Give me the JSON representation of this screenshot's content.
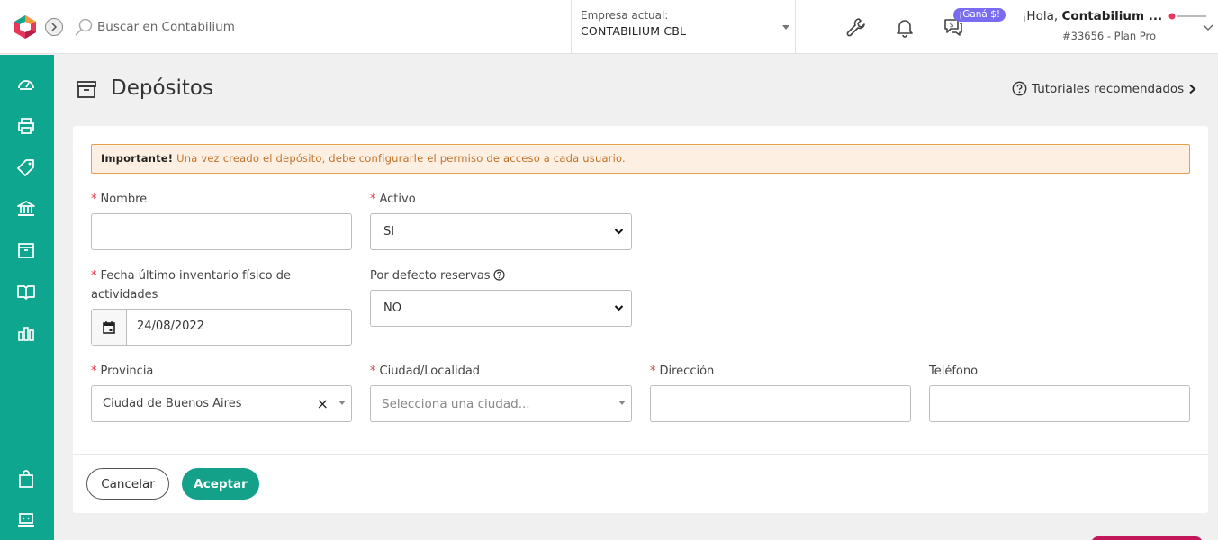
{
  "header": {
    "search_placeholder": "Buscar en Contabilium",
    "company_label": "Empresa actual:",
    "company_name": "CONTABILIUM CBL",
    "promo_badge": "¡Ganá $!",
    "greeting_prefix": "¡Hola, ",
    "greeting_name": "Contabilium ...",
    "account_plan": "#33656 - Plan Pro",
    "icons": [
      "wrench-icon",
      "bell-icon",
      "earn-chat-icon"
    ]
  },
  "sidebar": {
    "items": [
      "dashboard-icon",
      "printer-icon",
      "tag-icon",
      "bank-icon",
      "box-icon",
      "book-icon",
      "bar-chart-icon",
      "shopping-bag-icon",
      "computer-icon"
    ]
  },
  "page": {
    "title": "Depósitos",
    "tutorials_label": "Tutoriales recomendados"
  },
  "alert": {
    "strong": "Importante!",
    "text": " Una vez creado el depósito, debe configurarle el permiso de acceso a cada usuario."
  },
  "form": {
    "nombre_label": "Nombre",
    "nombre_value": "",
    "activo_label": "Activo",
    "activo_value": "SI",
    "fecha_label": "Fecha último inventario físico de actividades",
    "fecha_value": "24/08/2022",
    "reservas_label": "Por defecto reservas",
    "reservas_value": "NO",
    "provincia_label": "Provincia",
    "provincia_value": "Ciudad de Buenos Aires",
    "ciudad_label": "Ciudad/Localidad",
    "ciudad_placeholder": "Selecciona una ciudad...",
    "direccion_label": "Dirección",
    "direccion_value": "",
    "telefono_label": "Teléfono",
    "telefono_value": "",
    "required_mark": "*"
  },
  "actions": {
    "cancel_label": "Cancelar",
    "accept_label": "Aceptar"
  },
  "colors": {
    "brand": "#0ea68f",
    "accent": "#13a189",
    "alert_bg": "#fdf0e3",
    "alert_border": "#e3a14f",
    "required": "#e0364b",
    "promo": "#7a6cf0"
  }
}
